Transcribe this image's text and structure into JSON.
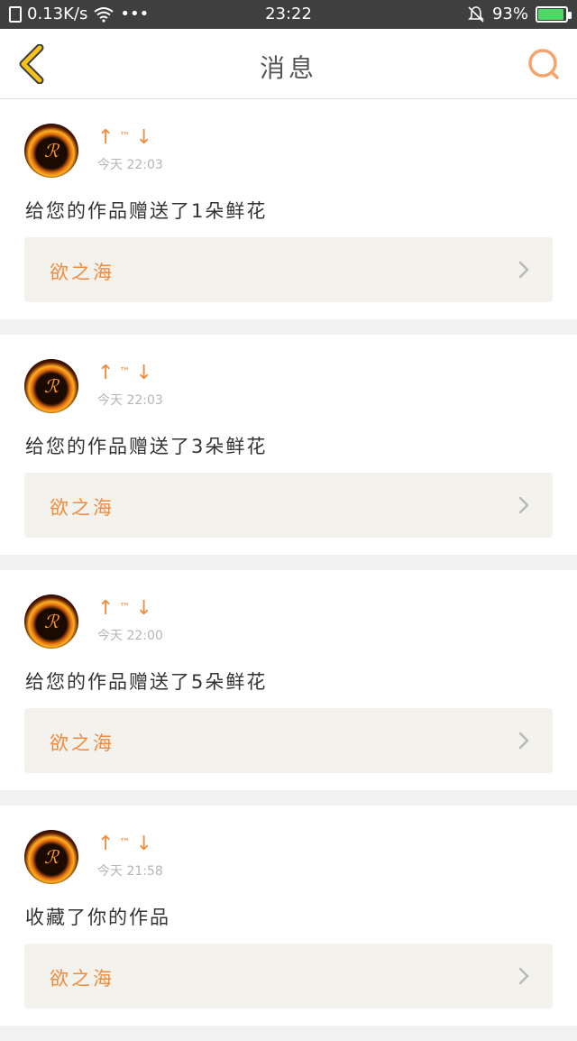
{
  "status": {
    "speed": "0.13K/s",
    "dots": "•••",
    "time": "23:22",
    "battery": "93%"
  },
  "header": {
    "title": "消息"
  },
  "colors": {
    "accent": "#f08b3e",
    "back_icon": "#f5c21a"
  },
  "messages": [
    {
      "user_left": "↑",
      "user_tm": "™",
      "user_right": "↓",
      "time": "今天 22:03",
      "text": "给您的作品赠送了1朵鲜花",
      "work": "欲之海"
    },
    {
      "user_left": "↑",
      "user_tm": "™",
      "user_right": "↓",
      "time": "今天 22:03",
      "text": "给您的作品赠送了3朵鲜花",
      "work": "欲之海"
    },
    {
      "user_left": "↑",
      "user_tm": "™",
      "user_right": "↓",
      "time": "今天 22:00",
      "text": "给您的作品赠送了5朵鲜花",
      "work": "欲之海"
    },
    {
      "user_left": "↑",
      "user_tm": "™",
      "user_right": "↓",
      "time": "今天 21:58",
      "text": "收藏了你的作品",
      "work": "欲之海"
    }
  ]
}
